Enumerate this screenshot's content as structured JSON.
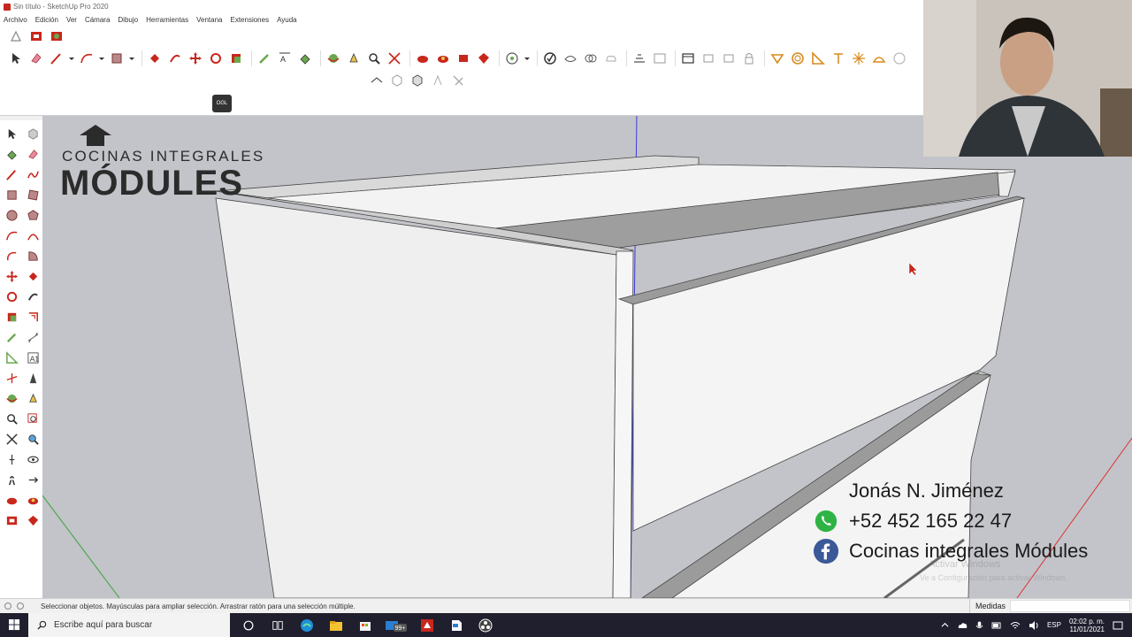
{
  "window": {
    "title": "Sin título - SketchUp Pro 2020"
  },
  "menu": [
    "Archivo",
    "Edición",
    "Ver",
    "Cámara",
    "Dibujo",
    "Herramientas",
    "Ventana",
    "Extensiones",
    "Ayuda"
  ],
  "camera_badge": "OGL",
  "logo": {
    "line1": "COCINAS INTEGRALES",
    "line2": "MÓDULES"
  },
  "contact": {
    "name": "Jonás N. Jiménez",
    "phone": "+52 452 165 22 47",
    "facebook": "Cocinas integrales Módules"
  },
  "watermark": {
    "line1": "Activar Windows",
    "line2": "Ve a Configuración para activar Windows."
  },
  "status": {
    "hint": "Seleccionar objetos. Mayúsculas para ampliar selección. Arrastrar ratón para una selección múltiple.",
    "measure_label": "Medidas"
  },
  "taskbar": {
    "search_placeholder": "Escribe aquí para buscar",
    "badge": "99+",
    "lang": "ESP",
    "time": "02:02 p. m.",
    "date": "11/01/2021"
  },
  "colors": {
    "viewport": "#c2c4c9",
    "face_light": "#f2f2f2",
    "face_top": "#9c9c9c",
    "accent_red": "#c8271c",
    "whatsapp": "#2fb344",
    "facebook": "#3b5998",
    "taskbar": "#1f1f2e"
  }
}
